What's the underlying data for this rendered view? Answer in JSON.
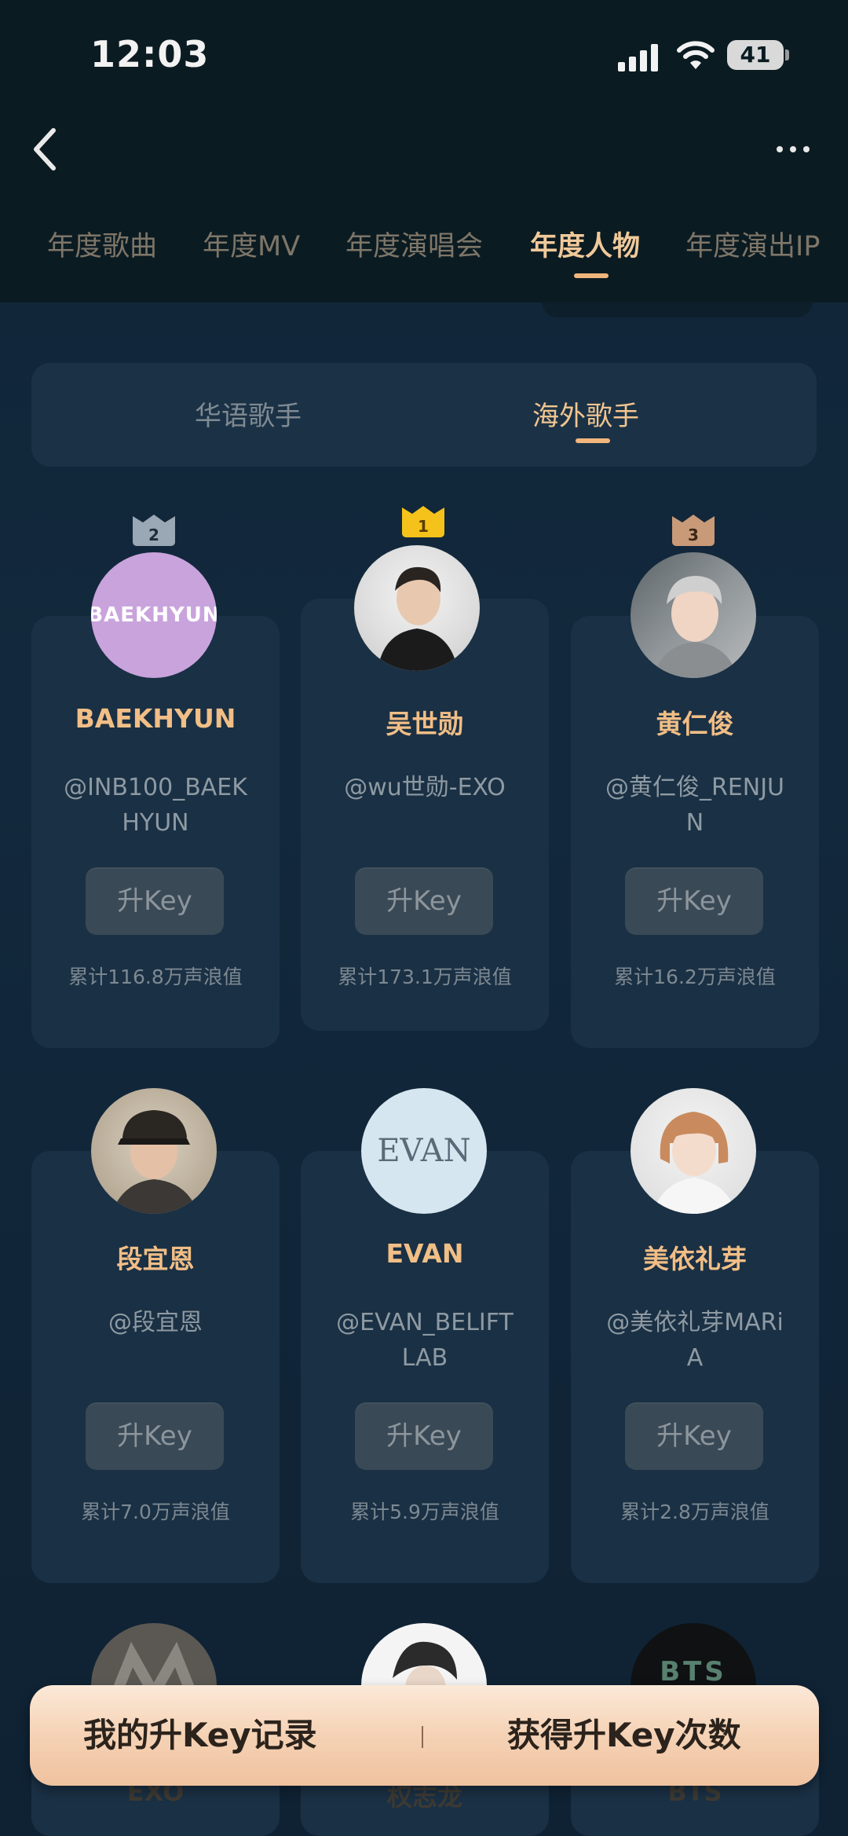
{
  "status_bar": {
    "time": "12:03",
    "battery": "41"
  },
  "tabs": [
    {
      "label": "年度歌曲",
      "active": false
    },
    {
      "label": "年度MV",
      "active": false
    },
    {
      "label": "年度演唱会",
      "active": false
    },
    {
      "label": "年度人物",
      "active": true
    },
    {
      "label": "年度演出IP",
      "active": false
    }
  ],
  "subtabs": {
    "inactive": "华语歌手",
    "active": "海外歌手"
  },
  "key_button_label": "升Key",
  "artists": [
    {
      "rank": "2",
      "avatar_text": "BAEKHYUN",
      "name": "BAEKHYUN",
      "handle": "@INB100_BAEKHYUN",
      "stat": "累计116.8万声浪值"
    },
    {
      "rank": "1",
      "avatar_text": "",
      "name": "吴世勋",
      "handle": "@wu世勋-EXO",
      "stat": "累计173.1万声浪值"
    },
    {
      "rank": "3",
      "avatar_text": "",
      "name": "黄仁俊",
      "handle": "@黄仁俊_RENJUN",
      "stat": "累计16.2万声浪值"
    },
    {
      "rank": "",
      "avatar_text": "",
      "name": "段宜恩",
      "handle": "@段宜恩",
      "stat": "累计7.0万声浪值"
    },
    {
      "rank": "",
      "avatar_text": "EVAN",
      "name": "EVAN",
      "handle": "@EVAN_BELIFTLAB",
      "stat": "累计5.9万声浪值"
    },
    {
      "rank": "",
      "avatar_text": "",
      "name": "美依礼芽",
      "handle": "@美依礼芽MARiA",
      "stat": "累计2.8万声浪值"
    }
  ],
  "partial_row": [
    {
      "name": "EXO"
    },
    {
      "name": "权志龙"
    },
    {
      "name": "BTS",
      "avatar_text": "BTS"
    }
  ],
  "actions": {
    "left": "我的升Key记录",
    "right": "获得升Key次数"
  },
  "colors": {
    "accent": "#f2b67d",
    "crown_gold": "#f5c21b",
    "crown_silver": "#9aa7b4",
    "crown_bronze": "#c89a78"
  }
}
